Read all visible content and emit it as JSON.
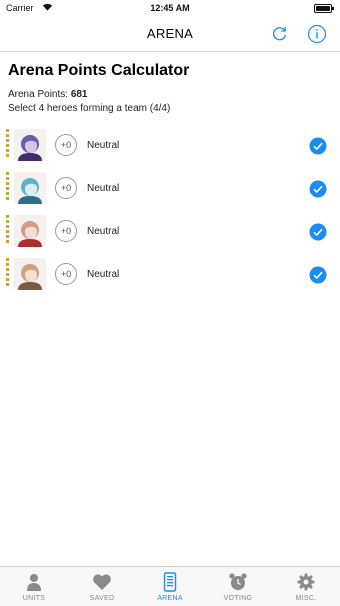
{
  "status_bar": {
    "carrier": "Carrier",
    "time": "12:45 AM"
  },
  "nav": {
    "title": "ARENA",
    "refresh_icon": "refresh-icon",
    "info_icon": "info-icon"
  },
  "content": {
    "heading": "Arena Points Calculator",
    "points_label": "Arena Points: ",
    "points_value": "681",
    "select_text": "Select 4 heroes forming a team (4/4)"
  },
  "heroes": [
    {
      "merge": "+0",
      "boon": "Neutral",
      "selected": true,
      "colors": [
        "#6b5ab0",
        "#d7c6e8",
        "#3e2f6a"
      ]
    },
    {
      "merge": "+0",
      "boon": "Neutral",
      "selected": true,
      "colors": [
        "#5fb3c9",
        "#d9eef2",
        "#2f6f86"
      ]
    },
    {
      "merge": "+0",
      "boon": "Neutral",
      "selected": true,
      "colors": [
        "#d79a86",
        "#f4ddd4",
        "#b02b2b"
      ]
    },
    {
      "merge": "+0",
      "boon": "Neutral",
      "selected": true,
      "colors": [
        "#caa27e",
        "#f1e1d0",
        "#7a5a42"
      ]
    }
  ],
  "tabs": [
    {
      "label": "UNITS",
      "icon": "person-icon",
      "active": false
    },
    {
      "label": "SAVED",
      "icon": "heart-icon",
      "active": false
    },
    {
      "label": "ARENA",
      "icon": "document-icon",
      "active": true
    },
    {
      "label": "VOTING",
      "icon": "alarm-clock-icon",
      "active": false
    },
    {
      "label": "MISC.",
      "icon": "gear-icon",
      "active": false
    }
  ],
  "colors": {
    "accent": "#1a8cf2",
    "rarity_gold": "#c7a63a",
    "tab_inactive": "#888888"
  }
}
